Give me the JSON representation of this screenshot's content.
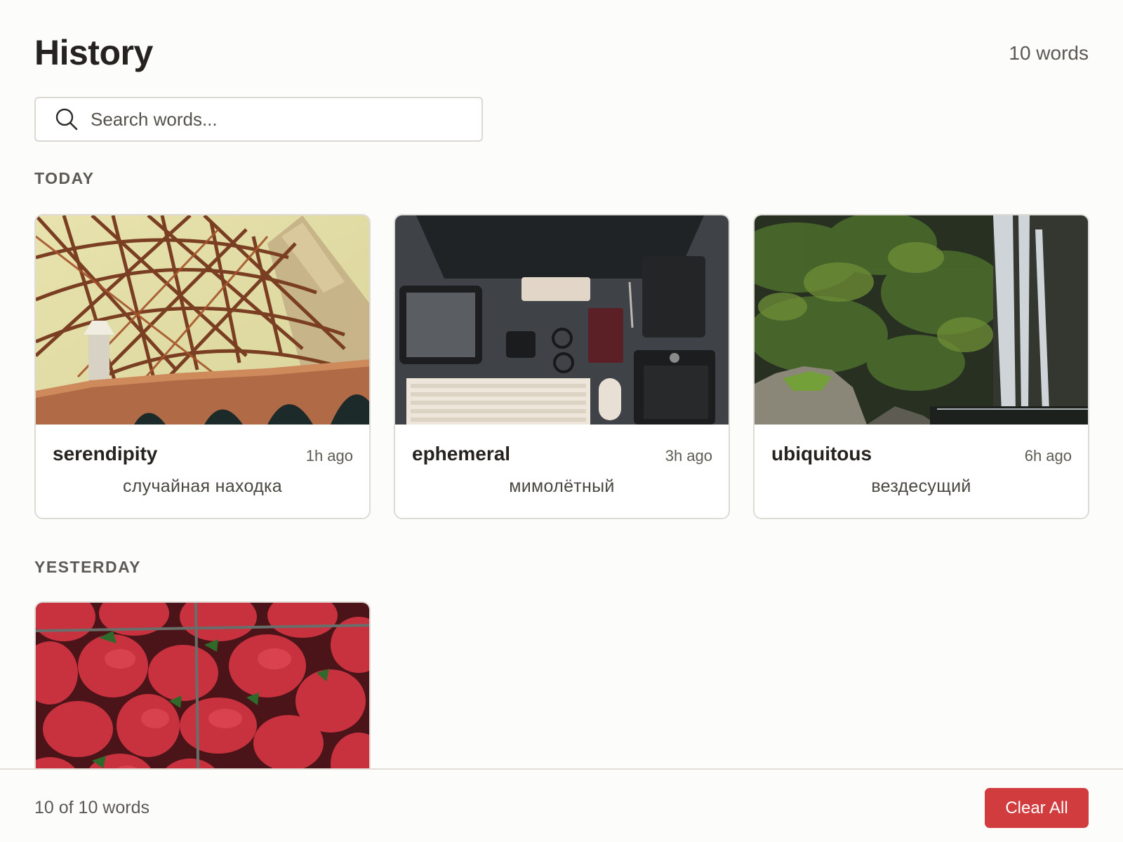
{
  "header": {
    "title": "History",
    "word_count": "10 words"
  },
  "search": {
    "placeholder": "Search words..."
  },
  "sections": [
    {
      "label": "TODAY",
      "cards": [
        {
          "word": "serendipity",
          "time": "1h ago",
          "translation": "случайная находка",
          "image": "bridge-photo"
        },
        {
          "word": "ephemeral",
          "time": "3h ago",
          "translation": "мимолётный",
          "image": "desk-photo"
        },
        {
          "word": "ubiquitous",
          "time": "6h ago",
          "translation": "вездесущий",
          "image": "waterfall-photo"
        }
      ]
    },
    {
      "label": "YESTERDAY",
      "cards": [
        {
          "image": "strawberries-photo"
        }
      ]
    }
  ],
  "footer": {
    "status": "10 of 10 words",
    "clear_label": "Clear All"
  },
  "colors": {
    "accent": "#d13d3f",
    "background": "#fcfcfb",
    "card_border": "#dedbd7"
  },
  "icons": {
    "search": "search-icon"
  }
}
